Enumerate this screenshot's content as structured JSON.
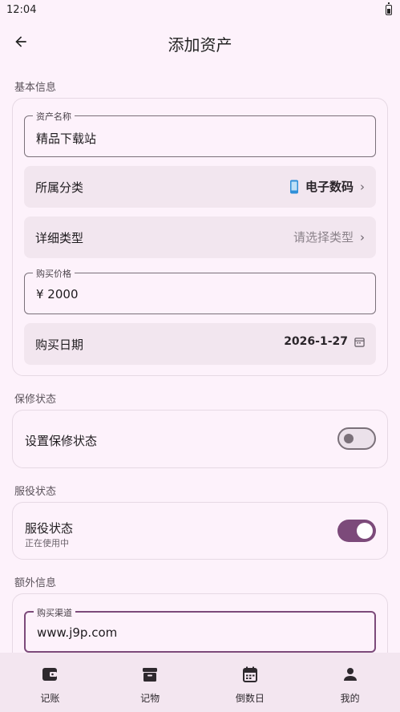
{
  "status_bar": {
    "time": "12:04"
  },
  "header": {
    "title": "添加资产"
  },
  "basic_info": {
    "section_label": "基本信息",
    "name_field": {
      "label": "资产名称",
      "value": "精品下载站"
    },
    "category": {
      "label": "所属分类",
      "value": "电子数码",
      "icon": "smartphone-icon"
    },
    "detail_type": {
      "label": "详细类型",
      "placeholder": "请选择类型"
    },
    "price_field": {
      "label": "购买价格",
      "value": "¥ 2000"
    },
    "purchase_date": {
      "label": "购买日期",
      "value": "2026-1-27"
    }
  },
  "warranty": {
    "section_label": "保修状态",
    "switch_label": "设置保修状态",
    "enabled": false
  },
  "service": {
    "section_label": "服役状态",
    "switch_label": "服役状态",
    "sub_label": "正在使用中",
    "enabled": true
  },
  "extra_info": {
    "section_label": "额外信息",
    "channel_field": {
      "label": "购买渠道",
      "value": "www.j9p.com"
    }
  },
  "bottom_nav": {
    "items": [
      {
        "label": "记账",
        "icon": "wallet-icon"
      },
      {
        "label": "记物",
        "icon": "archive-box-icon"
      },
      {
        "label": "倒数日",
        "icon": "calendar-icon"
      },
      {
        "label": "我的",
        "icon": "person-icon"
      }
    ]
  },
  "colors": {
    "background": "#fdf2fb",
    "accent": "#7c4a7a",
    "row_fill": "#f2e6ef",
    "category_icon": "#2f8fd8"
  }
}
